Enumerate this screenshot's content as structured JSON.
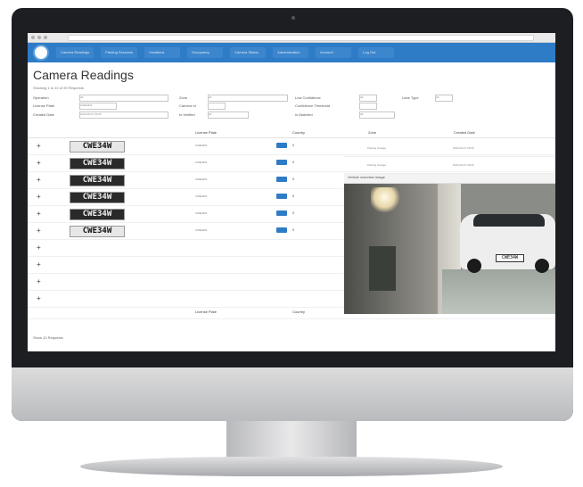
{
  "nav": {
    "items": [
      "Camera Readings",
      "Parking Sessions",
      "Violations",
      "Occupancy",
      "Camera Status",
      "Administration",
      "Account",
      "Log Out"
    ]
  },
  "page": {
    "title": "Camera Readings",
    "subtitle": "Showing 1 to 10 of 90 Requests"
  },
  "filters": {
    "operation_label": "Operation",
    "operation_value": "All",
    "license_plate_label": "License Plate",
    "license_plate_value": "CWE34W",
    "created_date_label": "Created Date",
    "created_date_value": "2022-09-27 00:00",
    "zone_label": "Zone",
    "zone_value": "All",
    "camera_id_label": "Camera Id",
    "verified_label": "Is Verified",
    "verified_value": "All",
    "low_conf_label": "Low Confidence",
    "low_conf_value": "All",
    "conf_threshold_label": "Confidence Threshold",
    "matched_label": "Is Matched",
    "matched_value": "All",
    "lane_type_label": "Lane Type",
    "lane_type_value": "All"
  },
  "table": {
    "headers": {
      "license_plate": "License Plate",
      "country": "Country",
      "zone": "Zone",
      "created_date": "Created Date"
    },
    "rows": [
      {
        "plate": "CWE34W",
        "lp": "CWE34W",
        "country": "0"
      },
      {
        "plate": "CWE34W",
        "lp": "CWE34W",
        "country": "0"
      },
      {
        "plate": "CWE34W",
        "lp": "CWE34W",
        "country": "0"
      },
      {
        "plate": "CWE34W",
        "lp": "CWE34W",
        "country": "0"
      },
      {
        "plate": "CWE34W",
        "lp": "CWE34W",
        "country": "0"
      },
      {
        "plate": "CWE34W",
        "lp": "CWE34W",
        "country": "0"
      }
    ],
    "empty_row_count": 4,
    "footer_headers": {
      "license_plate": "License Plate",
      "country": "Country"
    },
    "footer_text": "Show 10 Requests"
  },
  "right_panel": {
    "rows": [
      {
        "zone": "Parking Garage",
        "date": "2022-09-27 09:00"
      },
      {
        "zone": "Parking Garage",
        "date": "2022-09-27 09:00"
      }
    ],
    "image_caption": "Vehicle overview image",
    "car_plate_text": "CWE34W"
  },
  "colors": {
    "navbar": "#2f7cc6",
    "accent": "#2f7cc6"
  }
}
